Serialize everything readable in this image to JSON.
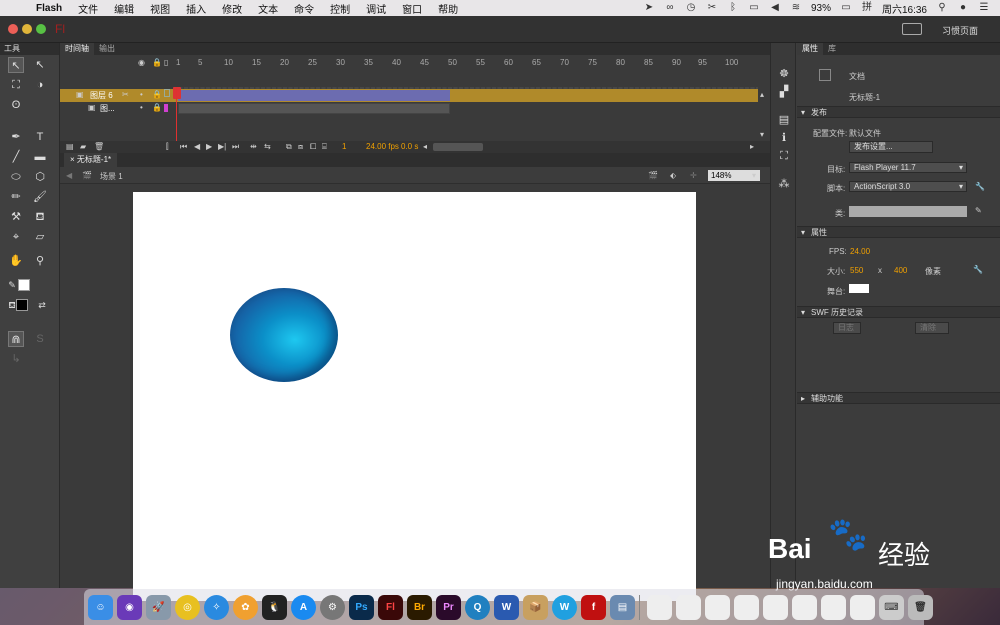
{
  "menubar": {
    "app": "Flash",
    "items": [
      "文件",
      "编辑",
      "视图",
      "插入",
      "修改",
      "文本",
      "命令",
      "控制",
      "调试",
      "窗口",
      "帮助"
    ],
    "battery": "93%",
    "clock": "周六16:36"
  },
  "titlebar": {
    "logo": "Fl",
    "workspace": "习惯页面"
  },
  "tools": {
    "tab": "工具"
  },
  "timeline": {
    "tabs": [
      "时间轴",
      "输出"
    ],
    "ruler": [
      "1",
      "5",
      "10",
      "15",
      "20",
      "25",
      "30",
      "35",
      "40",
      "45",
      "50",
      "55",
      "60",
      "65",
      "70",
      "75",
      "80",
      "85",
      "90",
      "95",
      "100"
    ],
    "layers": [
      "图层 6",
      "图..."
    ],
    "current_frame": "1",
    "fps": "24.00 fps",
    "time": "0.0 s"
  },
  "document": {
    "tab": "无标题-1*",
    "scene": "场景 1",
    "zoom": "148%"
  },
  "properties": {
    "tabs": [
      "属性",
      "库"
    ],
    "doc_type": "文档",
    "doc_name": "无标题-1",
    "publish": {
      "header": "发布",
      "profile_label": "配置文件:",
      "profile_value": "默认文件",
      "settings_button": "发布设置...",
      "target_label": "目标:",
      "target_value": "Flash Player 11.7",
      "script_label": "脚本:",
      "script_value": "ActionScript 3.0",
      "class_label": "类:"
    },
    "attrs": {
      "header": "属性",
      "fps_label": "FPS:",
      "fps_value": "24.00",
      "size_label": "大小:",
      "width": "550",
      "x": "x",
      "height": "400",
      "unit": "像素",
      "stage_label": "舞台:"
    },
    "swf": {
      "header": "SWF 历史记录",
      "log": "日志",
      "clear": "清除"
    },
    "access": {
      "header": "辅助功能"
    }
  },
  "watermark": {
    "brand": "Bai",
    "brand2": "经验",
    "url": "jingyan.baidu.com"
  },
  "dock": {
    "apps": [
      "Ps",
      "Fl",
      "Br",
      "Pr",
      "W"
    ]
  }
}
